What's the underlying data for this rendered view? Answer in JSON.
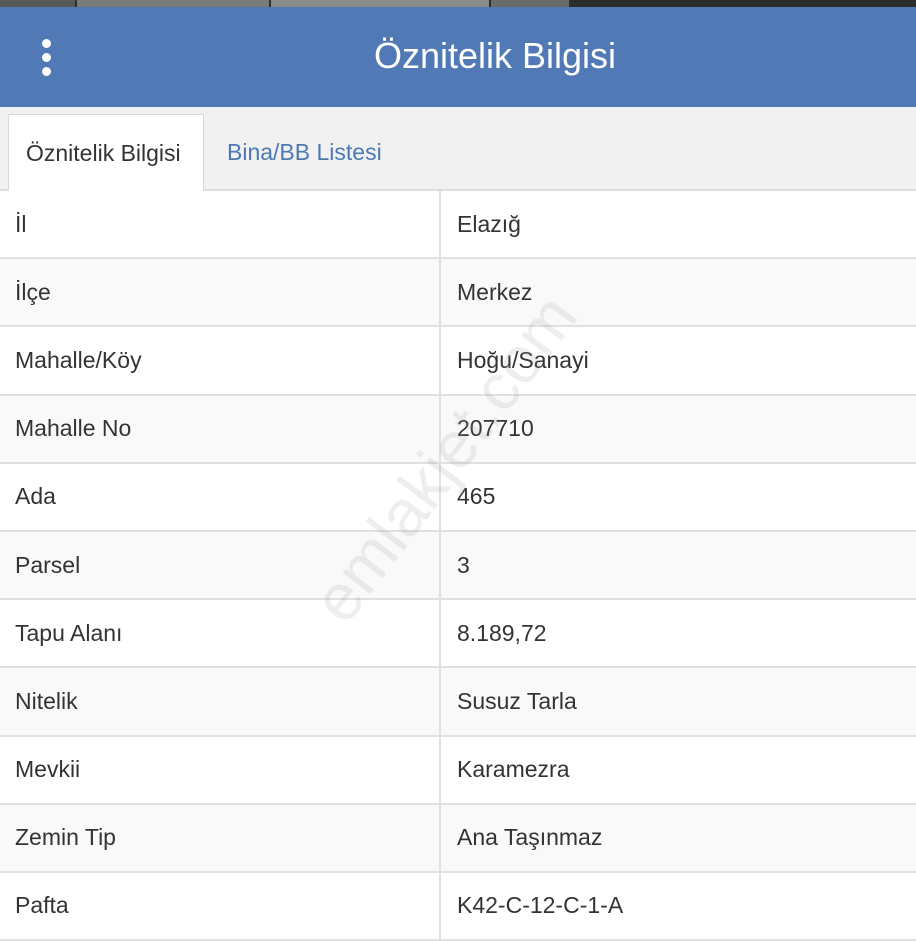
{
  "colors": {
    "header_bg": "#5079b5",
    "tab_link": "#4d79b3",
    "text": "#333333"
  },
  "header": {
    "menu_icon": "more-vertical-icon",
    "title": "Öznitelik Bilgisi"
  },
  "tabs": [
    {
      "label": "Öznitelik Bilgisi",
      "active": true
    },
    {
      "label": "Bina/BB Listesi",
      "active": false
    }
  ],
  "rows": [
    {
      "key": "İl",
      "value": "Elazığ"
    },
    {
      "key": "İlçe",
      "value": "Merkez"
    },
    {
      "key": "Mahalle/Köy",
      "value": "Hoğu/Sanayi"
    },
    {
      "key": "Mahalle No",
      "value": "207710"
    },
    {
      "key": "Ada",
      "value": "465"
    },
    {
      "key": "Parsel",
      "value": "3"
    },
    {
      "key": "Tapu Alanı",
      "value": "8.189,72"
    },
    {
      "key": "Nitelik",
      "value": "Susuz Tarla"
    },
    {
      "key": "Mevkii",
      "value": "Karamezra"
    },
    {
      "key": "Zemin Tip",
      "value": "Ana Taşınmaz"
    },
    {
      "key": "Pafta",
      "value": "K42-C-12-C-1-A"
    }
  ],
  "watermark": "emlakjet.com"
}
